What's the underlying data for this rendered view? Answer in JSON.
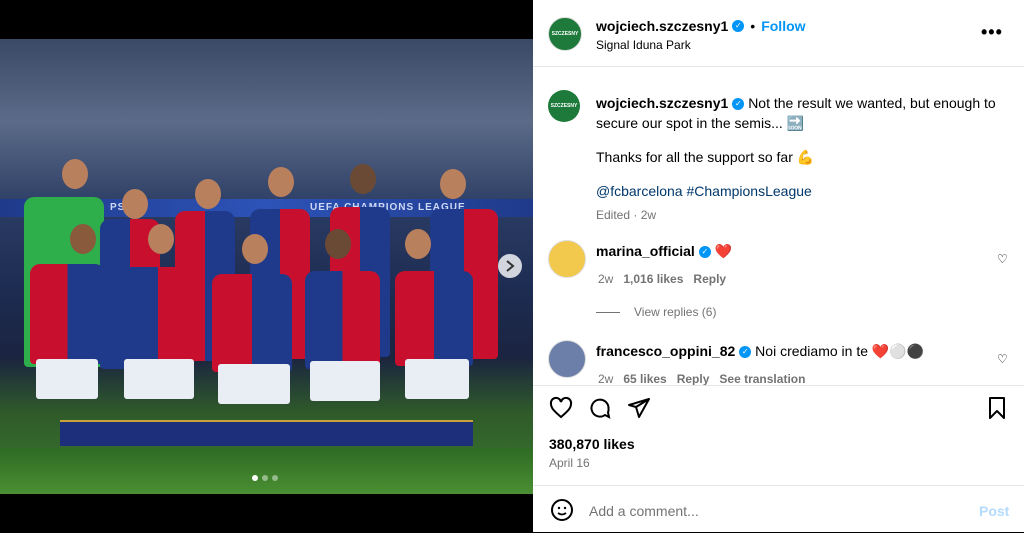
{
  "post": {
    "username": "wojciech.szczesny1",
    "separator": "•",
    "follow_label": "Follow",
    "location": "Signal Iduna Park",
    "more_icon": "more-horizontal-icon",
    "avatar_text": "SZCZESNY"
  },
  "caption": {
    "username": "wojciech.szczesny1",
    "text_line1": "Not the result we wanted, but enough to secure our spot in the semis...",
    "text_line2": "Thanks for all the support so far",
    "emoji_soon": "🔜",
    "emoji_flex": "💪",
    "mention": "@fcbarcelona",
    "hashtag": "#ChampionsLeague",
    "edited": "Edited",
    "time": "2w"
  },
  "comments": [
    {
      "username": "marina_official",
      "text": "❤️",
      "time": "2w",
      "likes": "1,016 likes",
      "reply_label": "Reply",
      "avatar_color": "#f2c94c"
    },
    {
      "username": "francesco_oppini_82",
      "text": "Noi crediamo in te ❤️⚪⚫",
      "time": "2w",
      "likes": "65 likes",
      "reply_label": "Reply",
      "translate_label": "See translation",
      "avatar_color": "#6b7fa8"
    }
  ],
  "view_replies": "View replies (6)",
  "likes_count": "380,870 likes",
  "date": "April 16",
  "add_comment_placeholder": "Add a comment...",
  "post_label": "Post",
  "photo": {
    "stand_text_left": "PS5",
    "stand_text_right": "UEFA CHAMPIONS LEAGUE"
  },
  "colors": {
    "accent": "#0095f6",
    "barca_blue": "#1f3a8a",
    "barca_red": "#c8102e"
  }
}
